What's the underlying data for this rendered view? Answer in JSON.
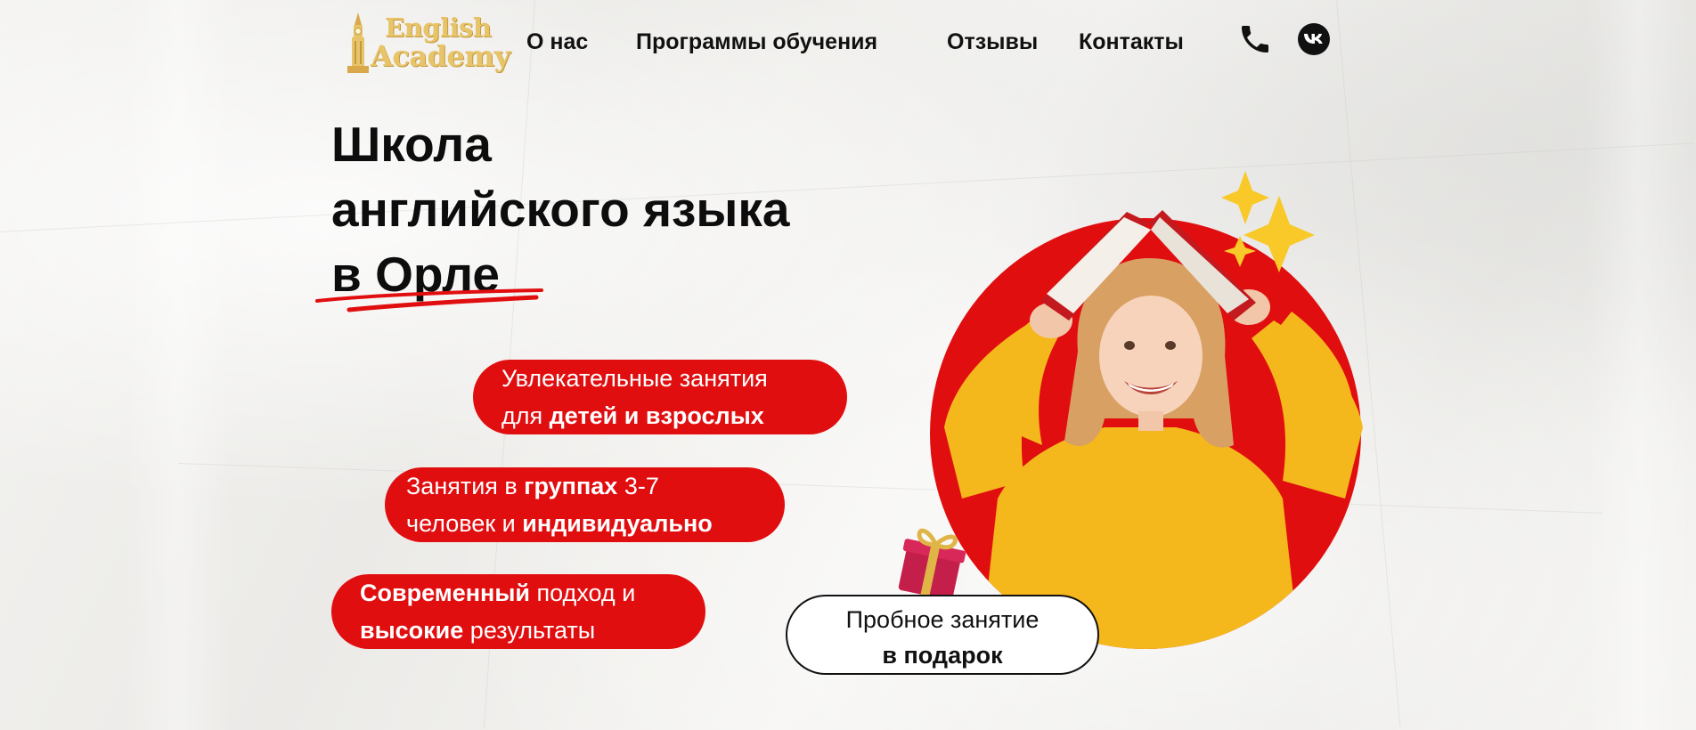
{
  "header": {
    "logo": {
      "line1": "English",
      "line2": "Academy",
      "icon": "big-ben-icon"
    },
    "nav": [
      "О нас",
      "Программы обучения",
      "Отзывы",
      "Контакты"
    ],
    "phone_icon": "phone-icon",
    "vk_icon": "vk-icon"
  },
  "hero": {
    "title_lines": [
      "Школа",
      "английского языка",
      "в Орле"
    ]
  },
  "features": [
    {
      "l1a": "Увлекательные занятия",
      "l2a": "для ",
      "l2b": "детей и взрослых"
    },
    {
      "l1a": "Занятия в ",
      "l1b": "группах",
      "l1c": " 3-7",
      "l2a": "человек и ",
      "l2b": "индивидуально"
    },
    {
      "l1b": "Современный",
      "l1c": " подход и",
      "l2b": "высокие",
      "l2c": " результаты"
    }
  ],
  "trial": {
    "line1": "Пробное занятие",
    "line2": "в подарок",
    "gift_icon": "gift-icon"
  },
  "colors": {
    "accent": "#e10e10",
    "text": "#0d0d0d",
    "shirt": "#f5b81c",
    "logo_gold": "#e7c46a"
  }
}
